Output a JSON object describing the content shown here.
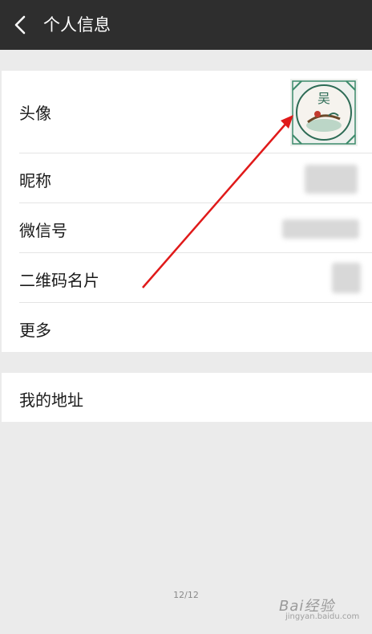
{
  "header": {
    "back_icon": "chevron-left-icon",
    "title": "个人信息",
    "background": "#2e2e2e"
  },
  "profile": {
    "rows": [
      {
        "label": "头像"
      },
      {
        "label": "昵称"
      },
      {
        "label": "微信号"
      },
      {
        "label": "二维码名片"
      },
      {
        "label": "更多"
      }
    ],
    "avatar_text": "吴"
  },
  "address": {
    "label": "我的地址"
  },
  "pager": "12/12",
  "watermark": {
    "brand": "Bai经验",
    "sub": "jingyan.baidu.com"
  },
  "annotation": {
    "arrow_color": "#e01a1a"
  }
}
